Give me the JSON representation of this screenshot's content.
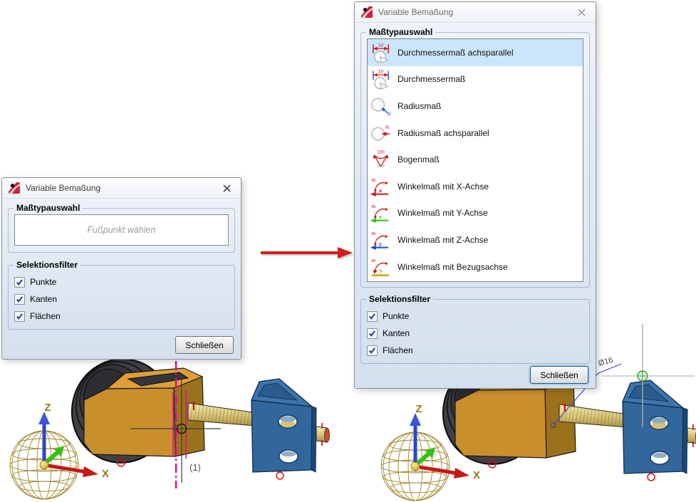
{
  "left_dialog": {
    "title": "Variable Bemaßung",
    "masstyp_group": {
      "label": "Maßtypauswahl",
      "placeholder": "Fußpunkt wählen"
    },
    "filter_group": {
      "label": "Selektionsfilter",
      "options": [
        {
          "label": "Punkte",
          "checked": true
        },
        {
          "label": "Kanten",
          "checked": true
        },
        {
          "label": "Flächen",
          "checked": true
        }
      ]
    },
    "close_button_label": "Schließen"
  },
  "right_dialog": {
    "title": "Variable Bemaßung",
    "masstyp_group": {
      "label": "Maßtypauswahl",
      "items": [
        {
          "label": "Durchmessermaß achsparallel",
          "icon": "diameter-dim-axisparallel-icon",
          "badge": "10",
          "selected": true
        },
        {
          "label": "Durchmessermaß",
          "icon": "diameter-dim-icon",
          "badge": "10",
          "selected": false
        },
        {
          "label": "Radiusmaß",
          "icon": "radius-dim-icon",
          "badge": "R",
          "selected": false
        },
        {
          "label": "Radiusmaß achsparallel",
          "icon": "radius-dim-axisparallel-icon",
          "badge": "R",
          "selected": false
        },
        {
          "label": "Bogenmaß",
          "icon": "arc-dim-icon",
          "badge": "100",
          "selected": false
        },
        {
          "label": "Winkelmaß mit X-Achse",
          "icon": "angle-dim-x-axis-icon",
          "badge": "45",
          "axis": "X",
          "selected": false
        },
        {
          "label": "Winkelmaß mit Y-Achse",
          "icon": "angle-dim-y-axis-icon",
          "badge": "45",
          "axis": "Y",
          "selected": false
        },
        {
          "label": "Winkelmaß mit Z-Achse",
          "icon": "angle-dim-z-axis-icon",
          "badge": "45",
          "axis": "Z",
          "selected": false
        },
        {
          "label": "Winkelmaß mit Bezugsachse",
          "icon": "angle-dim-reference-axis-icon",
          "badge": "45",
          "axis": "?",
          "selected": false
        }
      ]
    },
    "filter_group": {
      "label": "Selektionsfilter",
      "options": [
        {
          "label": "Punkte",
          "checked": true
        },
        {
          "label": "Kanten",
          "checked": true
        },
        {
          "label": "Flächen",
          "checked": true
        }
      ]
    },
    "close_button_label": "Schließen"
  },
  "scene": {
    "axis_x_label": "X",
    "axis_z_label": "Z",
    "left_view": {
      "annotation": "(1)"
    },
    "right_view": {
      "dimension_label": "Ø16"
    }
  },
  "colors": {
    "selection_highlight": "#cbe6fb",
    "dialog_body_bottom": "#d5e0ee",
    "dimension_red": "#cc1111",
    "axis_x_red": "#c81616",
    "axis_y_green": "#2fc214",
    "axis_z_blue": "#2a46cf",
    "magenta_axis": "#e800a0",
    "part_orange": "#c98f2c",
    "part_blue": "#31679d",
    "part_gold": "#d8c376",
    "wheel_dark": "#3f3f45",
    "arrow_red": "#cf1f1f"
  }
}
